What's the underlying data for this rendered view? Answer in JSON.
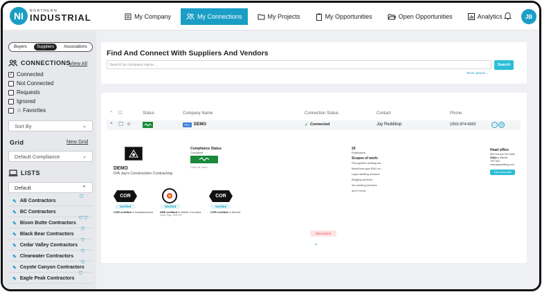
{
  "app": {
    "logo_initials": "NI",
    "logo_small": "NORTHERN",
    "logo_big": "INDUSTRIAL",
    "avatar": "JB",
    "accent": "#1b9ec6"
  },
  "nav": [
    {
      "label": "My Company",
      "icon": "building-icon",
      "active": false
    },
    {
      "label": "My Connections",
      "icon": "people-icon",
      "active": true
    },
    {
      "label": "My Projects",
      "icon": "folder-icon",
      "active": false
    },
    {
      "label": "My Opportunities",
      "icon": "clipboard-icon",
      "active": false
    },
    {
      "label": "Open Opportunities",
      "icon": "folder-open-icon",
      "active": false
    },
    {
      "label": "Analytics",
      "icon": "chart-icon",
      "active": false
    }
  ],
  "sidebar": {
    "segments": [
      "Buyers",
      "Suppliers",
      "Associations"
    ],
    "active_segment": "Suppliers",
    "connections_title": "CONNECTIONS",
    "view_all": "View All",
    "filters": [
      {
        "label": "Connected",
        "checked": true
      },
      {
        "label": "Not Connected",
        "checked": false
      },
      {
        "label": "Requests",
        "checked": false
      },
      {
        "label": "Ignored",
        "checked": false
      },
      {
        "label": "Favorites",
        "checked": false
      }
    ],
    "sort_by": "Sort By",
    "grid_title": "Grid",
    "new_grid": "New Grid",
    "grid_select": "Default Compliance",
    "lists_title": "LISTS",
    "lists_select": "Default",
    "lists": [
      "AB Contractors",
      "BC Contractors",
      "Bison Butte Contractors",
      "Black Bear Contractors",
      "Cedar Valley Contractors",
      "Clearwater Contractors",
      "Coyote Canyon Contractors",
      "Eagle Peak Contractors"
    ]
  },
  "main": {
    "title": "Find And Connect With Suppliers And Vendors",
    "search_placeholder": "Search by company name...",
    "search_button": "Search",
    "show_options": "Show options ⌄",
    "headers": {
      "status": "Status",
      "company": "Company Name",
      "connection": "Connection Status",
      "contact": "Contact",
      "phone": "Phone"
    },
    "row": {
      "badge": "PRO",
      "company": "DEMO",
      "connection": "Connected",
      "contact": "Jay Reddikop",
      "phone": "(250) 874-6952"
    },
    "detail": {
      "company": "DEMO",
      "dba": "D/A Jay's Construction Contracting",
      "compliance_title": "Compliance Status",
      "compliance_value": "Compliant",
      "click_more": "Click for more...",
      "employees": "20",
      "employees_label": "Employees",
      "scopes_title": "Scopes of work:",
      "scopes": [
        "Pre-pipeline welding ser...",
        "Metal fram gas RHD ce...",
        "Layer welding services",
        "Bridging services",
        "Arc welding services",
        "and 9 more..."
      ],
      "head_office_title": "Head office",
      "head_office_lines": [
        "800 2nd Ave SW Suite #800",
        "Calgary, Alberta",
        "T2P 3K5",
        "www.jayswelding.com"
      ],
      "full_profile": "View full profile",
      "disconnect": "Disconnect",
      "certs": [
        {
          "logo": "COR",
          "verified": "Verified",
          "bold": "COR certified",
          "rest": " in Saskatchewan",
          "sub": ""
        },
        {
          "logo": "",
          "verified": "Verified",
          "bold": "SHE certified",
          "rest": " in British Columbia",
          "sub": "Audit Type: SMHVR"
        },
        {
          "logo": "COR",
          "verified": "Verified",
          "bold": "COR certified",
          "rest": " in Alberta",
          "sub": ""
        }
      ]
    }
  }
}
